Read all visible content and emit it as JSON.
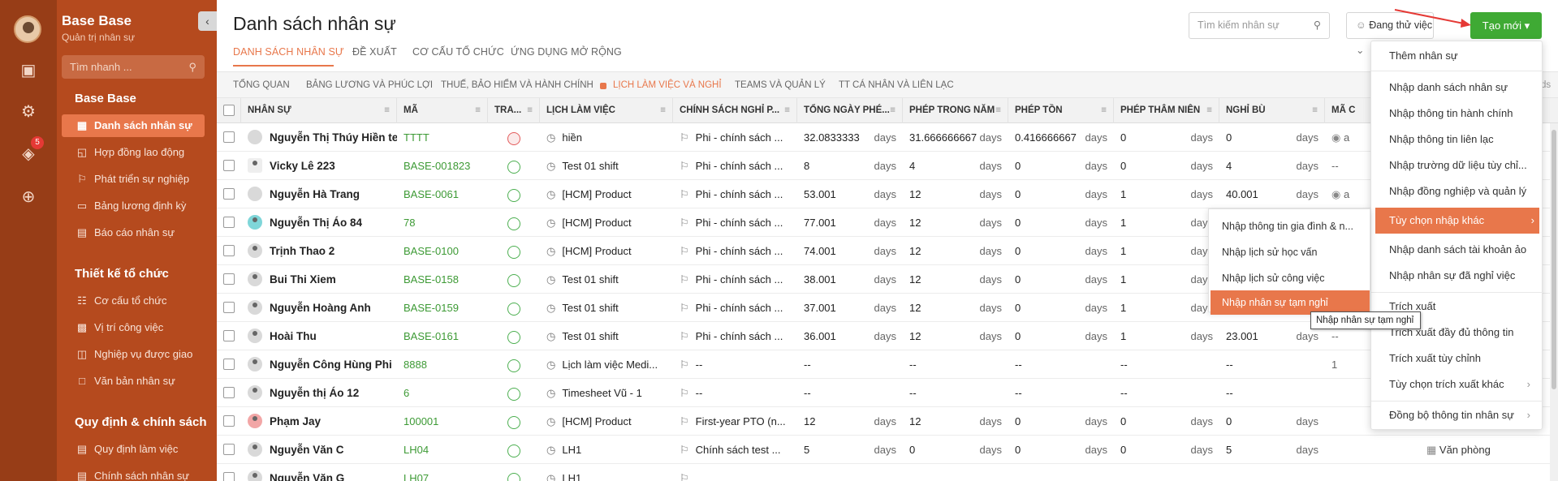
{
  "sidebar": {
    "org_name": "Base Base",
    "org_subtitle": "Quản trị nhân sự",
    "quick_search_placeholder": "Tìm nhanh ...",
    "notification_count": "5",
    "sections": [
      {
        "title": "Base Base",
        "items": [
          {
            "label": "Danh sách nhân sự",
            "icon": "grid-icon",
            "active": true
          },
          {
            "label": "Hợp đồng lao động",
            "icon": "bookmark-icon"
          },
          {
            "label": "Phát triển sự nghiệp",
            "icon": "flag-icon"
          },
          {
            "label": "Bảng lương định kỳ",
            "icon": "briefcase-icon"
          },
          {
            "label": "Báo cáo nhân sự",
            "icon": "bar-chart-icon"
          }
        ]
      },
      {
        "title": "Thiết kế tổ chức",
        "items": [
          {
            "label": "Cơ cấu tổ chức",
            "icon": "org-chart-icon"
          },
          {
            "label": "Vị trí công việc",
            "icon": "id-card-icon"
          },
          {
            "label": "Nghiệp vụ được giao",
            "icon": "book-icon"
          },
          {
            "label": "Văn bản nhân sự",
            "icon": "folder-icon"
          }
        ]
      },
      {
        "title": "Quy định & chính sách",
        "items": [
          {
            "label": "Quy định làm việc",
            "icon": "document-icon"
          },
          {
            "label": "Chính sách nhân sự",
            "icon": "document-icon"
          }
        ]
      }
    ]
  },
  "header": {
    "title": "Danh sách nhân sự",
    "tabs": [
      "DANH SÁCH NHÂN SỰ",
      "ĐỀ XUẤT",
      "CƠ CẤU TỔ CHỨC",
      "ỨNG DỤNG MỞ RỘNG"
    ],
    "search_placeholder": "Tìm kiếm nhân sự",
    "status_filter": "Đang thử việc",
    "create_label": "Tạo mới"
  },
  "subtabs": [
    "TỔNG QUAN",
    "BẢNG LƯƠNG VÀ PHÚC LỢI",
    "THUẾ, BẢO HIỂM VÀ HÀNH CHÍNH",
    "LỊCH LÀM VIỆC VÀ NGHỈ",
    "TEAMS VÀ QUẢN LÝ",
    "TT CÁ NHÂN VÀ LIÊN LẠC"
  ],
  "subtab_overflow": "ds",
  "table": {
    "columns": [
      "NHÂN SỰ",
      "MÃ",
      "TRA...",
      "LỊCH LÀM VIỆC",
      "CHÍNH SÁCH NGHỈ P...",
      "TỔNG NGÀY PHÉ...",
      "PHÉP TRONG NĂM",
      "PHÉP TỒN",
      "PHÉP THÂM NIÊN",
      "NGHỈ BÙ",
      "MÃ C"
    ],
    "unit": "days",
    "rows": [
      {
        "name": "Nguyễn Thị Thúy Hiền te...",
        "code": "TTTT",
        "status": "red",
        "schedule": "hiền",
        "policy": "Phi - chính sách ...",
        "total": "32.0833333",
        "year": "31.666666667",
        "remain": "0.416666667",
        "senior": "0",
        "comp": "0",
        "extra": "a",
        "right": ""
      },
      {
        "name": "Vicky Lê 223",
        "code": "BASE-001823",
        "status": "green",
        "schedule": "Test 01 shift",
        "policy": "Phi - chính sách ...",
        "total": "8",
        "year": "4",
        "remain": "0",
        "senior": "0",
        "comp": "4",
        "extra": "--",
        "right": ""
      },
      {
        "name": "Nguyễn Hà Trang",
        "code": "BASE-0061",
        "status": "green",
        "schedule": "[HCM] Product",
        "policy": "Phi - chính sách ...",
        "total": "53.001",
        "year": "12",
        "remain": "0",
        "senior": "1",
        "comp": "40.001",
        "extra": "a",
        "right": ""
      },
      {
        "name": "Nguyễn Thị Áo 84",
        "code": "78",
        "status": "green",
        "schedule": "[HCM] Product",
        "policy": "Phi - chính sách ...",
        "total": "77.001",
        "year": "12",
        "remain": "0",
        "senior": "1",
        "comp": "",
        "extra": "",
        "right": ""
      },
      {
        "name": "Trịnh Thao 2",
        "code": "BASE-0100",
        "status": "green",
        "schedule": "[HCM] Product",
        "policy": "Phi - chính sách ...",
        "total": "74.001",
        "year": "12",
        "remain": "0",
        "senior": "1",
        "comp": "",
        "extra": "",
        "right": ""
      },
      {
        "name": "Bui Thi Xiem",
        "code": "BASE-0158",
        "status": "green",
        "schedule": "Test 01 shift",
        "policy": "Phi - chính sách ...",
        "total": "38.001",
        "year": "12",
        "remain": "0",
        "senior": "1",
        "comp": "",
        "extra": "",
        "right": ""
      },
      {
        "name": "Nguyễn Hoàng Anh",
        "code": "BASE-0159",
        "status": "green",
        "schedule": "Test 01 shift",
        "policy": "Phi - chính sách ...",
        "total": "37.001",
        "year": "12",
        "remain": "0",
        "senior": "1",
        "comp": "",
        "extra": "",
        "right": ""
      },
      {
        "name": "Hoài Thu",
        "code": "BASE-0161",
        "status": "green",
        "schedule": "Test 01 shift",
        "policy": "Phi - chính sách ...",
        "total": "36.001",
        "year": "12",
        "remain": "0",
        "senior": "1",
        "comp": "23.001",
        "extra": "--",
        "right": ""
      },
      {
        "name": "Nguyễn Công Hùng Phi",
        "code": "8888",
        "status": "green",
        "schedule": "Lịch làm việc Medi...",
        "policy": "--",
        "total": "--",
        "year": "--",
        "remain": "--",
        "senior": "--",
        "comp": "--",
        "extra": "1",
        "right": ""
      },
      {
        "name": "Nguyễn thị Áo 12",
        "code": "6",
        "status": "green",
        "schedule": "Timesheet Vũ - 1",
        "policy": "--",
        "total": "--",
        "year": "--",
        "remain": "--",
        "senior": "--",
        "comp": "--",
        "extra": "",
        "right": ""
      },
      {
        "name": "Phạm Jay",
        "code": "100001",
        "status": "green",
        "schedule": "[HCM] Product",
        "policy": "First-year PTO (n...",
        "total": "12",
        "year": "12",
        "remain": "0",
        "senior": "0",
        "comp": "0",
        "extra": "",
        "right": ""
      },
      {
        "name": "Nguyễn Văn C",
        "code": "LH04",
        "status": "green",
        "schedule": "LH1",
        "policy": "Chính sách test ...",
        "total": "5",
        "year": "0",
        "remain": "0",
        "senior": "0",
        "comp": "5",
        "extra": "",
        "right": "Văn phòng"
      },
      {
        "name": "Nguyễn Văn G",
        "code": "LH07",
        "status": "green",
        "schedule": "LH1",
        "policy": "",
        "total": "",
        "year": "",
        "remain": "",
        "senior": "",
        "comp": "",
        "extra": "",
        "right": ""
      }
    ]
  },
  "dropdown": {
    "items": [
      {
        "label": "Thêm nhân sự"
      },
      {
        "label": "Nhập danh sách nhân sự"
      },
      {
        "label": "Nhập thông tin hành chính"
      },
      {
        "label": "Nhập thông tin liên lạc"
      },
      {
        "label": "Nhập trường dữ liệu tùy chỉ..."
      },
      {
        "label": "Nhập đồng nghiệp và quản lý"
      },
      {
        "label": "Tùy chọn nhập khác",
        "submenu": true,
        "highlight": true
      },
      {
        "label": "Nhập danh sách tài khoản ảo"
      },
      {
        "label": "Nhập nhân sự đã nghỉ việc"
      },
      {
        "label": "Trích xuất"
      },
      {
        "label": "Trích xuất đầy đủ thông tin"
      },
      {
        "label": "Trích xuất tùy chỉnh"
      },
      {
        "label": "Tùy chọn trích xuất khác",
        "submenu": true
      },
      {
        "label": "Đồng bộ thông tin nhân sự",
        "submenu": true
      }
    ]
  },
  "submenu": {
    "items": [
      {
        "label": "Nhập thông tin gia đình & n..."
      },
      {
        "label": "Nhập lịch sử học vấn"
      },
      {
        "label": "Nhập lịch sử công việc"
      },
      {
        "label": "Nhập nhân sự tạm nghỉ",
        "highlight": true
      }
    ]
  },
  "tooltip": "Nhập nhân sự tạm nghỉ",
  "colors": {
    "sidebar": "#b54a1e",
    "accent": "#e8774b",
    "create": "#3faa34",
    "code": "#3d9a35"
  }
}
